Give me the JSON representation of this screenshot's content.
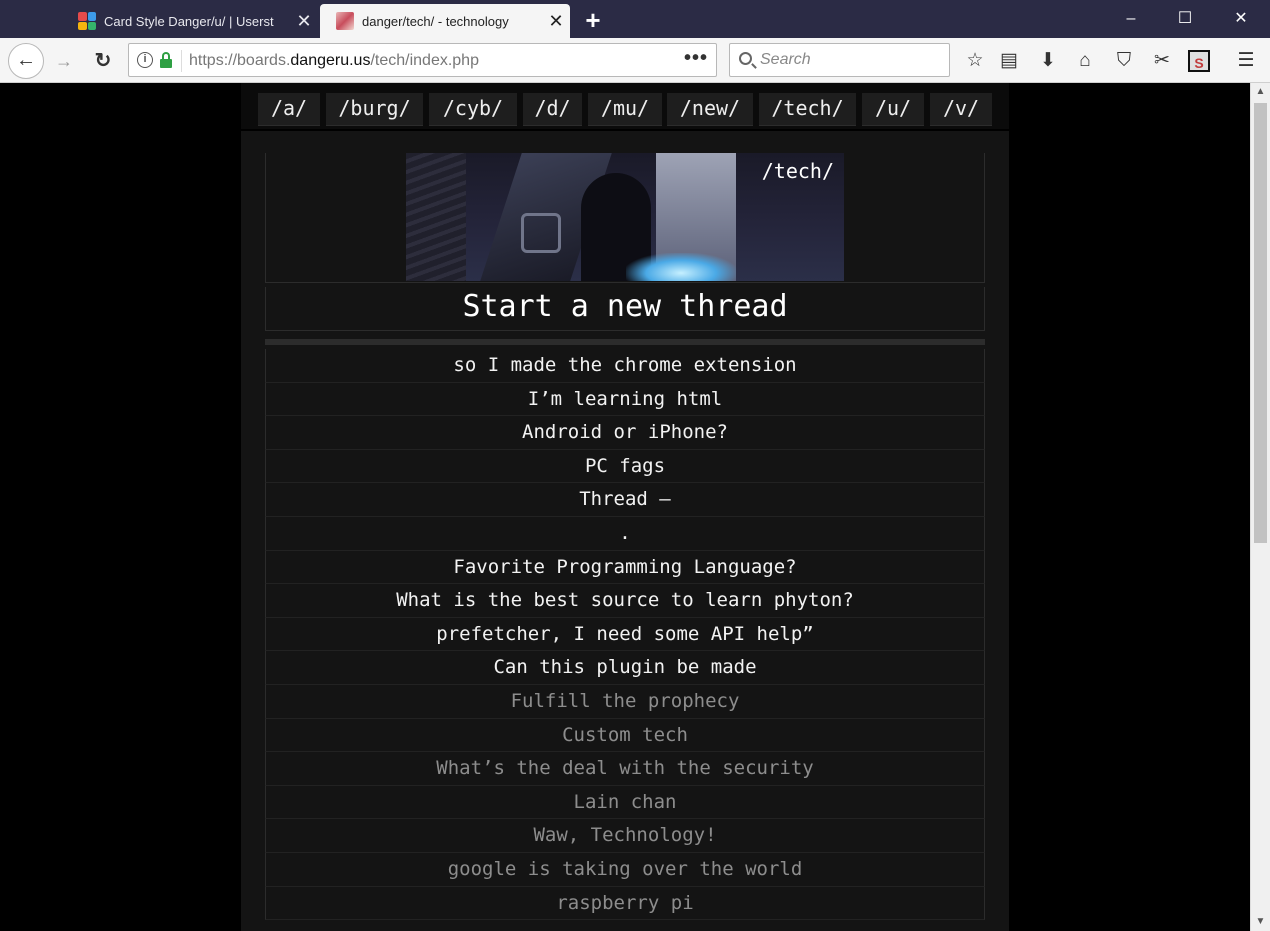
{
  "browser": {
    "tabs": [
      {
        "title": "Card Style Danger/u/ | Userst",
        "active": false
      },
      {
        "title": "danger/tech/ - technology",
        "active": true
      }
    ],
    "url": {
      "prefix": "https://boards.",
      "domain": "dangeru.us",
      "path": "/tech/index.php"
    },
    "search_placeholder": "Search",
    "icons": {
      "new_tab": "+",
      "minimize": "–",
      "maximize": "☐",
      "close": "✕",
      "back": "←",
      "forward": "→",
      "reload": "↻",
      "info": "i",
      "more": "•••",
      "bookmark_star": "☆",
      "reading_list": "▤",
      "download": "⬇",
      "home": "⌂",
      "pocket": "⛉",
      "scissors": "✂",
      "extension": "S",
      "menu": "☰",
      "scroll_up": "▲",
      "scroll_down": "▼"
    }
  },
  "page": {
    "boards": [
      "/a/",
      "/burg/",
      "/cyb/",
      "/d/",
      "/mu/",
      "/new/",
      "/tech/",
      "/u/",
      "/v/"
    ],
    "banner_label": "/tech/",
    "new_thread_label": "Start a new thread",
    "threads": [
      {
        "title": "so I made the chrome extension",
        "state": "fresh"
      },
      {
        "title": "I’m learning html",
        "state": "fresh"
      },
      {
        "title": "Android or iPhone?",
        "state": "fresh"
      },
      {
        "title": "PC fags",
        "state": "fresh"
      },
      {
        "title": "Thread –",
        "state": "fresh"
      },
      {
        "title": ".",
        "state": "fresh"
      },
      {
        "title": "Favorite Programming Language?",
        "state": "fresh"
      },
      {
        "title": "What is the best source to learn phyton?",
        "state": "fresh"
      },
      {
        "title": "prefetcher, I need some API help”",
        "state": "fresh"
      },
      {
        "title": "Can this plugin be made",
        "state": "fresh"
      },
      {
        "title": "Fulfill the prophecy",
        "state": "stale"
      },
      {
        "title": "Custom tech",
        "state": "stale"
      },
      {
        "title": "What’s the deal with the security",
        "state": "stale"
      },
      {
        "title": "Lain chan",
        "state": "stale"
      },
      {
        "title": "Waw, Technology!",
        "state": "stale"
      },
      {
        "title": "google is taking over the world",
        "state": "stale"
      },
      {
        "title": "raspberry pi",
        "state": "stale"
      }
    ]
  },
  "colors": {
    "titlebar": "#2b2b45",
    "page_bg": "#000000",
    "panel_bg": "#141414",
    "fresh_text": "#f2f2f2",
    "stale_text": "#8d8d8d",
    "secure_lock": "#2ea043"
  }
}
